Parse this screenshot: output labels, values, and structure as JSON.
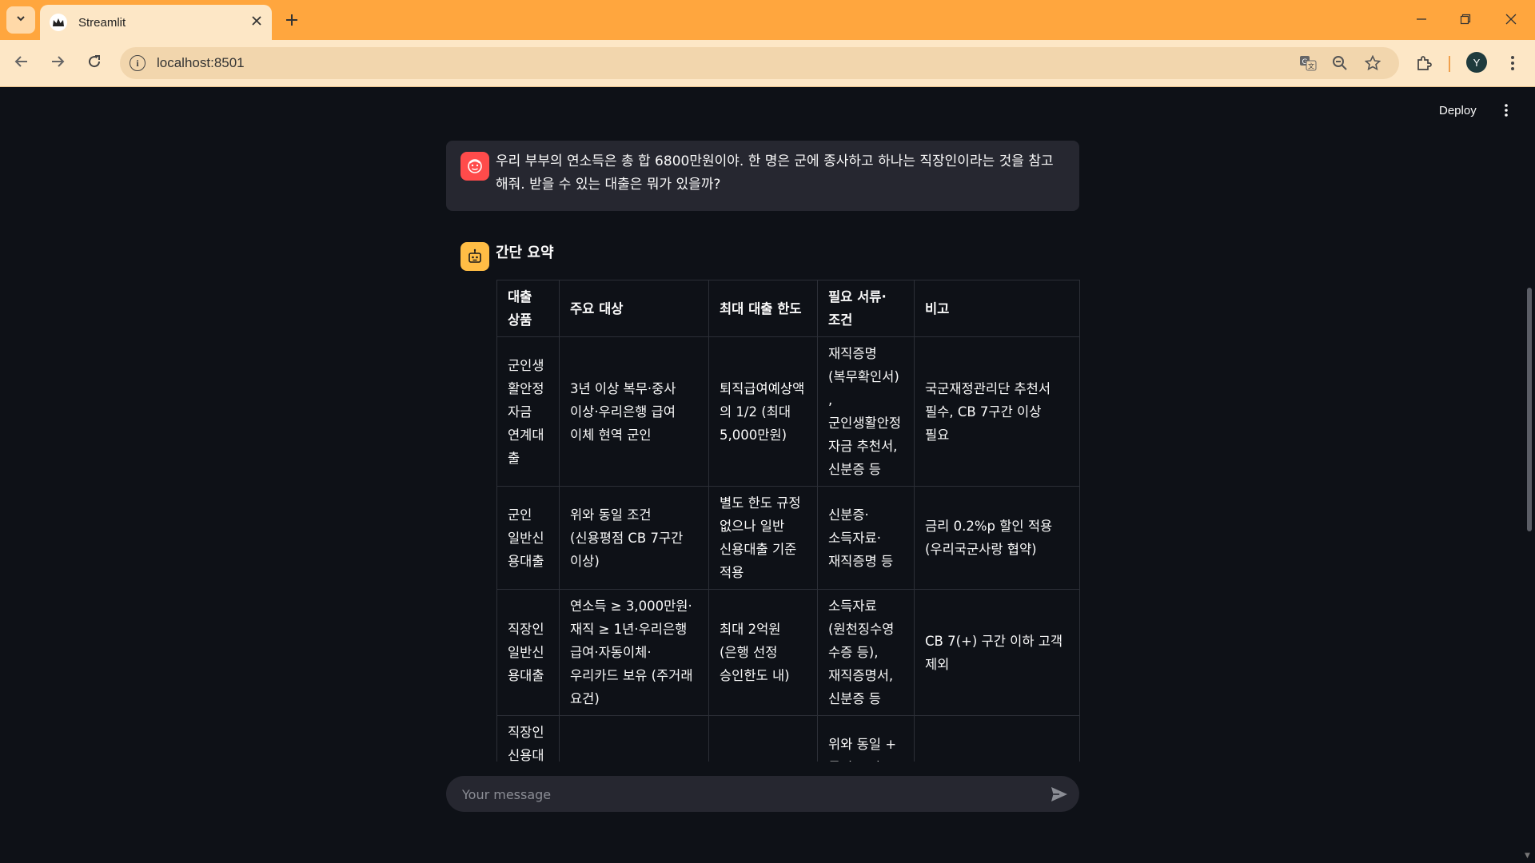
{
  "browser": {
    "tab_title": "Streamlit",
    "url": "localhost:8501",
    "profile_initial": "Y"
  },
  "icons": {
    "tab_search": "chevron-down-icon",
    "favicon": "streamlit-crown-icon",
    "close": "close-icon",
    "new_tab": "plus-icon",
    "back": "arrow-left-icon",
    "forward": "arrow-right-icon",
    "reload": "reload-icon",
    "site_info": "info-icon",
    "translate": "translate-icon",
    "zoom": "zoom-out-icon",
    "bookmark": "star-icon",
    "extensions": "puzzle-icon",
    "menu": "kebab-menu-icon",
    "send": "send-icon"
  },
  "app": {
    "deploy_label": "Deploy"
  },
  "chat": {
    "user_message": "우리 부부의 연소득은 총 합 6800만원이야. 한 명은 군에 종사하고 하나는 직장인이라는 것을 참고해줘. 받을 수 있는 대출은 뭐가 있을까?",
    "assistant_heading": "간단 요약",
    "table": {
      "headers": [
        "대출 상품",
        "주요 대상",
        "최대 대출 한도",
        "필요 서류·조건",
        "비고"
      ],
      "rows": [
        [
          "군인생활안정자금 연계대출",
          "3년 이상 복무·중사 이상·우리은행 급여 이체 현역 군인",
          "퇴직급여예상액의 1/2 (최대 5,000만원)",
          "재직증명(복무확인서), 군인생활안정자금 추천서, 신분증 등",
          "국군재정관리단 추천서 필수, CB 7구간 이상 필요"
        ],
        [
          "군인 일반신용대출",
          "위와 동일 조건(신용평점 CB 7구간 이상)",
          "별도 한도 규정 없으나 일반 신용대출 기준 적용",
          "신분증·소득자료·재직증명 등",
          "금리 0.2%p 할인 적용(우리국군사랑 협약)"
        ],
        [
          "직장인 일반신용대출",
          "연소득 ≥ 3,000만원·재직 ≥ 1년·우리은행 급여·자동이체·우리카드 보유 (주거래 요건)",
          "최대 2억원(은행 선정 승인한도 내)",
          "소득자료(원천징수영수증 등), 재직증명서, 신분증 등",
          "CB 7(+) 구간 이하 고객 제외"
        ],
        [
          "직장인 신용대출",
          "",
          "",
          "위와 동일 + 통신·공과금·",
          ""
        ]
      ]
    },
    "input_placeholder": "Your message"
  },
  "colors": {
    "tabstrip": "#ffa63e",
    "toolbar": "#fde7c6",
    "app_bg": "#0e1117",
    "message_bg": "#262730",
    "user_avatar": "#ff4b4b",
    "assistant_avatar": "#ffbd45"
  }
}
